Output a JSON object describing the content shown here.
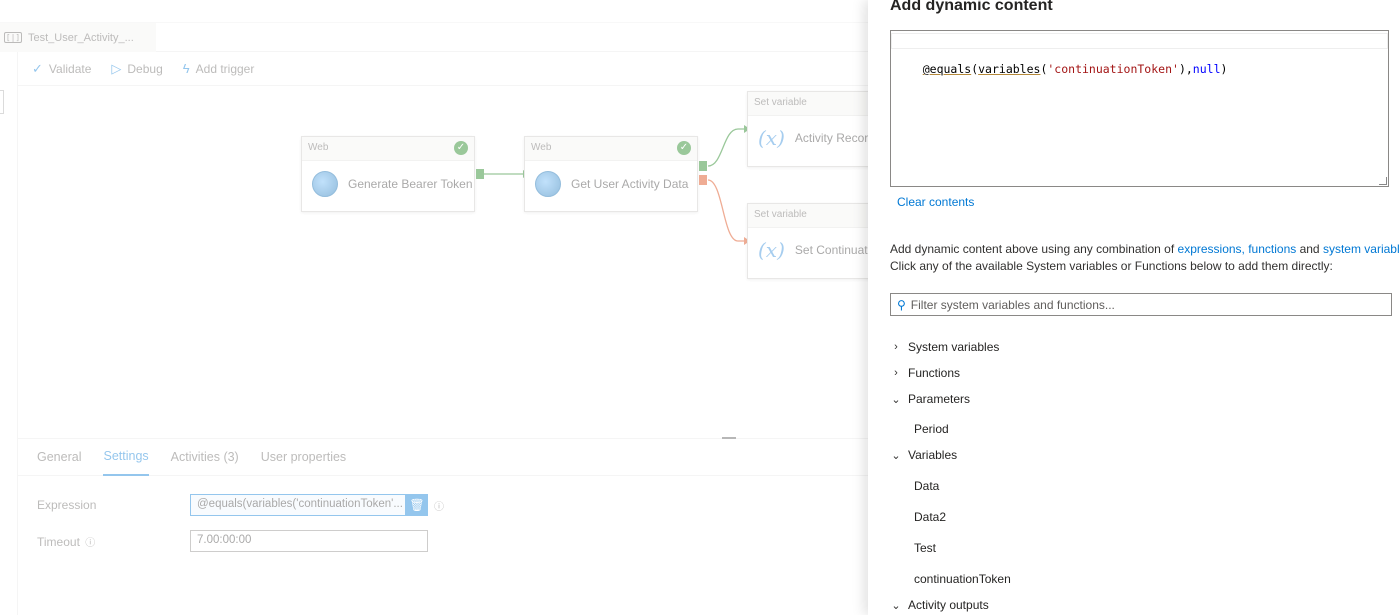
{
  "editor": {
    "pipeline_tab": "Test_User_Activity_...",
    "toolbar": {
      "validate": "Validate",
      "debug": "Debug",
      "add_trigger": "Add trigger"
    },
    "nodes": [
      {
        "type": "Web",
        "name": "Generate Bearer Token"
      },
      {
        "type": "Web",
        "name": "Get User Activity Data"
      },
      {
        "type": "Set variable",
        "name": "Activity Recor"
      },
      {
        "type": "Set variable",
        "name": "Set Continuat"
      }
    ],
    "bottom_tabs": [
      "General",
      "Settings",
      "Activities (3)",
      "User properties"
    ],
    "settings": {
      "expression_label": "Expression",
      "expression_value": "@equals(variables('continuationToken'...",
      "timeout_label": "Timeout",
      "timeout_value": "7.00:00:00"
    }
  },
  "pane": {
    "title": "Add dynamic content",
    "expression": {
      "at": "@",
      "fn1": "equals",
      "p1": "(",
      "fn2": "variables",
      "p2": "(",
      "str": "'continuationToken'",
      "p3": "),",
      "kw": "null",
      "p4": ")"
    },
    "clear_contents": "Clear contents",
    "help_prefix": "Add dynamic content above using any combination of ",
    "help_link1": "expressions, functions",
    "help_and": " and ",
    "help_link2": "system variables",
    "help_line2": "Click any of the available System variables or Functions below to add them directly:",
    "filter_placeholder": "Filter system variables and functions...",
    "tree": {
      "system_variables": "System variables",
      "functions": "Functions",
      "parameters": "Parameters",
      "parameter_items": [
        "Period"
      ],
      "variables": "Variables",
      "variable_items": [
        "Data",
        "Data2",
        "Test",
        "continuationToken"
      ],
      "activity_outputs": "Activity outputs"
    }
  }
}
